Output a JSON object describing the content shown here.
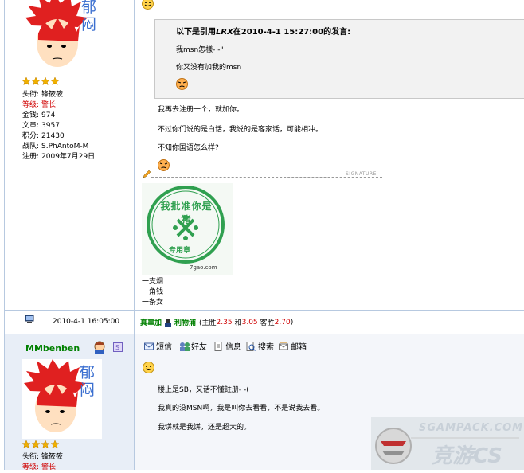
{
  "post1": {
    "user_info": [
      {
        "label": "头衔:",
        "value": "锋筱筱",
        "red": false
      },
      {
        "label": "等级:",
        "value": "警长",
        "red": true
      },
      {
        "label": "金钱:",
        "value": "974",
        "red": false
      },
      {
        "label": "文章:",
        "value": "3957",
        "red": false
      },
      {
        "label": "积分:",
        "value": "21430",
        "red": false
      },
      {
        "label": "战队:",
        "value": "S.PhAntoM-M",
        "red": false
      },
      {
        "label": "注册:",
        "value": "2009年7月29日",
        "red": false
      }
    ],
    "quote": {
      "header": "以下是引用",
      "user": "LRX",
      "header_mid": "在2010-4-1 15:27:00的发言:",
      "lines": [
        "我msn怎樣- -\"",
        "你又没有加我的msn"
      ]
    },
    "lines": [
      "我再去注册一个，就加你。",
      "不过你们说的是白话，我说的是客家话，可能相冲。",
      "不知你国语怎么样?"
    ],
    "signature_label": "SIGNATURE",
    "stamp": {
      "text": "我批准你是猪",
      "sub": "专用章",
      "source": "7gao.com"
    },
    "sig_lines": [
      "一支烟",
      "一角钱",
      "一条女"
    ],
    "avatar_text": "郁闷"
  },
  "footer_row": {
    "time": "2010-4-1 16:05:00",
    "bet_a": "真辜加",
    "bet_b": "利物浦",
    "odds_label_main": "(主胜",
    "odds_main": "2.35",
    "odds_label_draw": "和",
    "odds_draw": "3.05",
    "odds_label_away": "客胜",
    "odds_away": "2.70",
    "odds_close": ")"
  },
  "post2": {
    "username": "MMbenben",
    "toolbar": [
      "短信",
      "好友",
      "信息",
      "搜索",
      "邮箱"
    ],
    "lines": [
      "楼上是SB，又话不懂註册- -(",
      "我真的没MSN啊，我是叫你去看看，不是说我去看。",
      "我饼就是我饼，还是超大的。"
    ],
    "user_info": [
      {
        "label": "头衔:",
        "value": "锋筱筱",
        "red": false
      },
      {
        "label": "等级:",
        "value": "警长",
        "red": true
      }
    ],
    "avatar_text": "郁闷"
  },
  "watermark": {
    "top": "SGAMPACK.COM",
    "bottom": "竞游CS"
  },
  "colors": {
    "border": "#b7c9e0",
    "header_bg": "#e8eef7",
    "green": "#008000",
    "red": "#d00000",
    "blue": "#3050a0"
  }
}
